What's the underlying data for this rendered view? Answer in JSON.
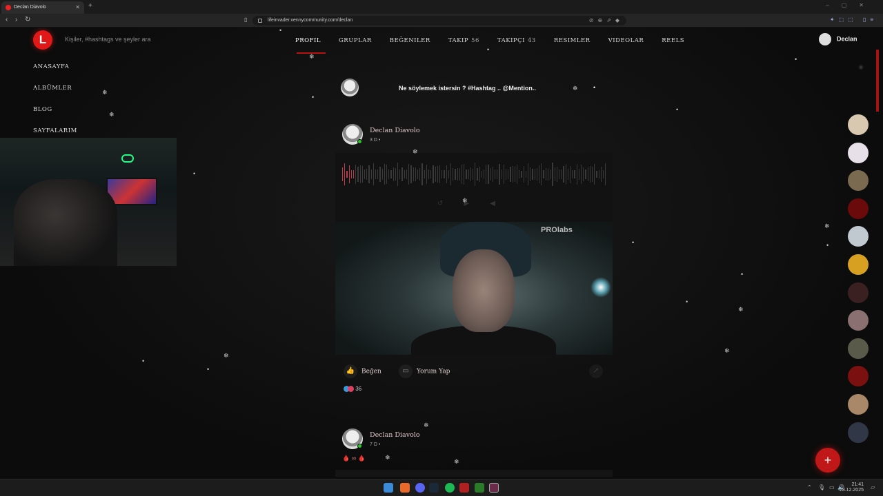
{
  "browser": {
    "tab_title": "Declan Diavolo",
    "new_tab_icon": "+",
    "url": "lifeinvader.vennycommunity.com/declan"
  },
  "header": {
    "logo_letter": "L",
    "search_placeholder": "Kişiler, #hashtags ve şeyler ara",
    "user_name": "Declan",
    "tabs": [
      {
        "label": "Profil",
        "count": ""
      },
      {
        "label": "Gruplar",
        "count": ""
      },
      {
        "label": "Beğeniler",
        "count": ""
      },
      {
        "label": "Takip",
        "count": "56"
      },
      {
        "label": "Takipçi",
        "count": "43"
      },
      {
        "label": "Resimler",
        "count": ""
      },
      {
        "label": "Videolar",
        "count": ""
      },
      {
        "label": "Reels",
        "count": ""
      }
    ]
  },
  "sidebar": {
    "items": [
      {
        "label": "Anasayfa"
      },
      {
        "label": "Albümler"
      },
      {
        "label": "Blog"
      },
      {
        "label": "Sayfalarim"
      }
    ]
  },
  "composer": {
    "placeholder": "Ne söylemek istersin ? #Hashtag .. @Mention.."
  },
  "posts": [
    {
      "author": "Declan Diavolo",
      "time": "3 D •",
      "media_text": "PROlabs",
      "like_label": "Beğen",
      "comment_label": "Yorum Yap",
      "reaction_count": "36",
      "audio_progress": 0.05
    },
    {
      "author": "Declan Diavolo",
      "time": "7 D •",
      "emoji_line": "🩸 ∞ 🩸"
    }
  ],
  "fab": {
    "icon": "+"
  },
  "taskbar": {
    "time": "21:41",
    "date": "28.12.2025"
  },
  "colors": {
    "accent": "#e01818",
    "audio_played": "#c23a4a",
    "online": "#22cc22"
  }
}
